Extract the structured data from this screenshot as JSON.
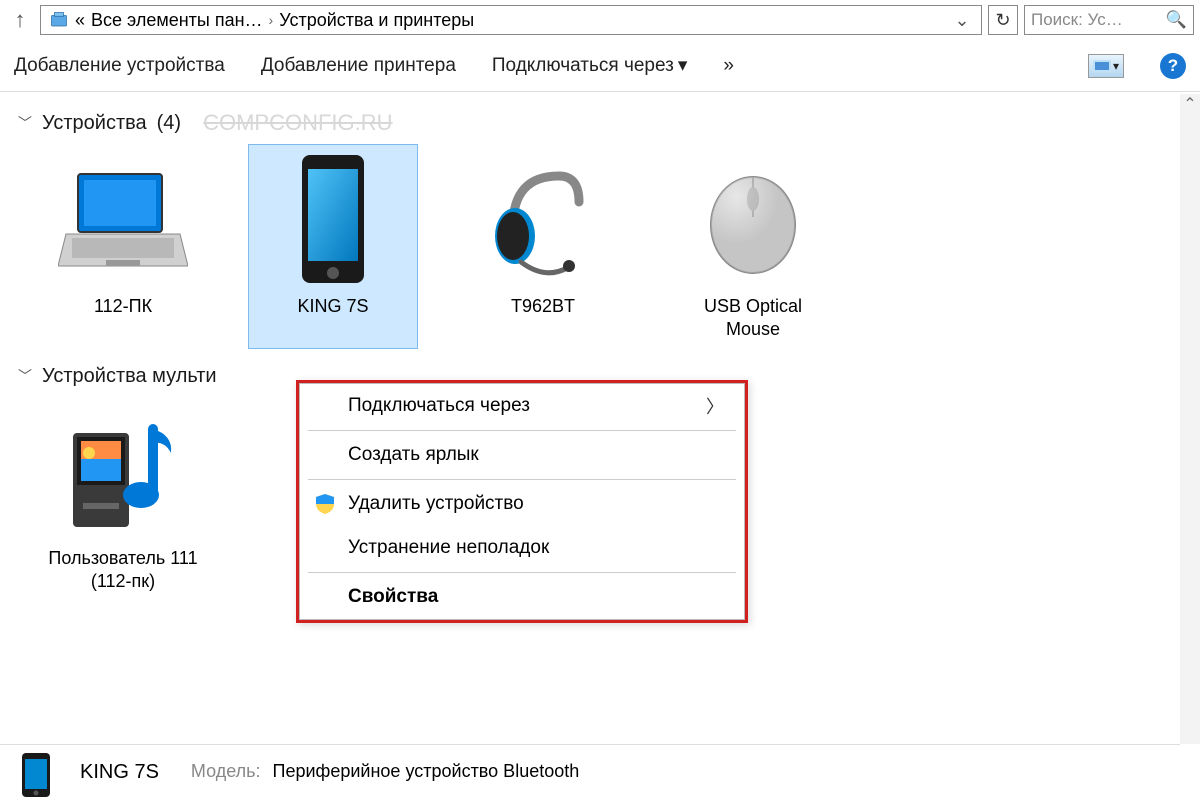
{
  "breadcrumb": {
    "segment1": "Все элементы пан…",
    "segment2": "Устройства и принтеры"
  },
  "search": {
    "placeholder": "Поиск: Ус…"
  },
  "toolbar": {
    "add_device": "Добавление устройства",
    "add_printer": "Добавление принтера",
    "connect_via": "Подключаться через",
    "more": "»"
  },
  "groups": {
    "devices": {
      "title": "Устройства",
      "count": "(4)",
      "watermark": "COMPCONFIG.RU"
    },
    "multimedia": {
      "title": "Устройства мульти"
    }
  },
  "devices": [
    {
      "label": "112-ПК"
    },
    {
      "label": "KING 7S"
    },
    {
      "label": "T962BT"
    },
    {
      "label": "USB Optical Mouse"
    }
  ],
  "multimedia": [
    {
      "label": "Пользователь 111 (112-пк)"
    }
  ],
  "context_menu": {
    "connect_via": "Подключаться через",
    "create_shortcut": "Создать ярлык",
    "remove_device": "Удалить устройство",
    "troubleshoot": "Устранение неполадок",
    "properties": "Свойства"
  },
  "details": {
    "name": "KING 7S",
    "model_label": "Модель:",
    "model_value": "Периферийное устройство Bluetooth"
  }
}
